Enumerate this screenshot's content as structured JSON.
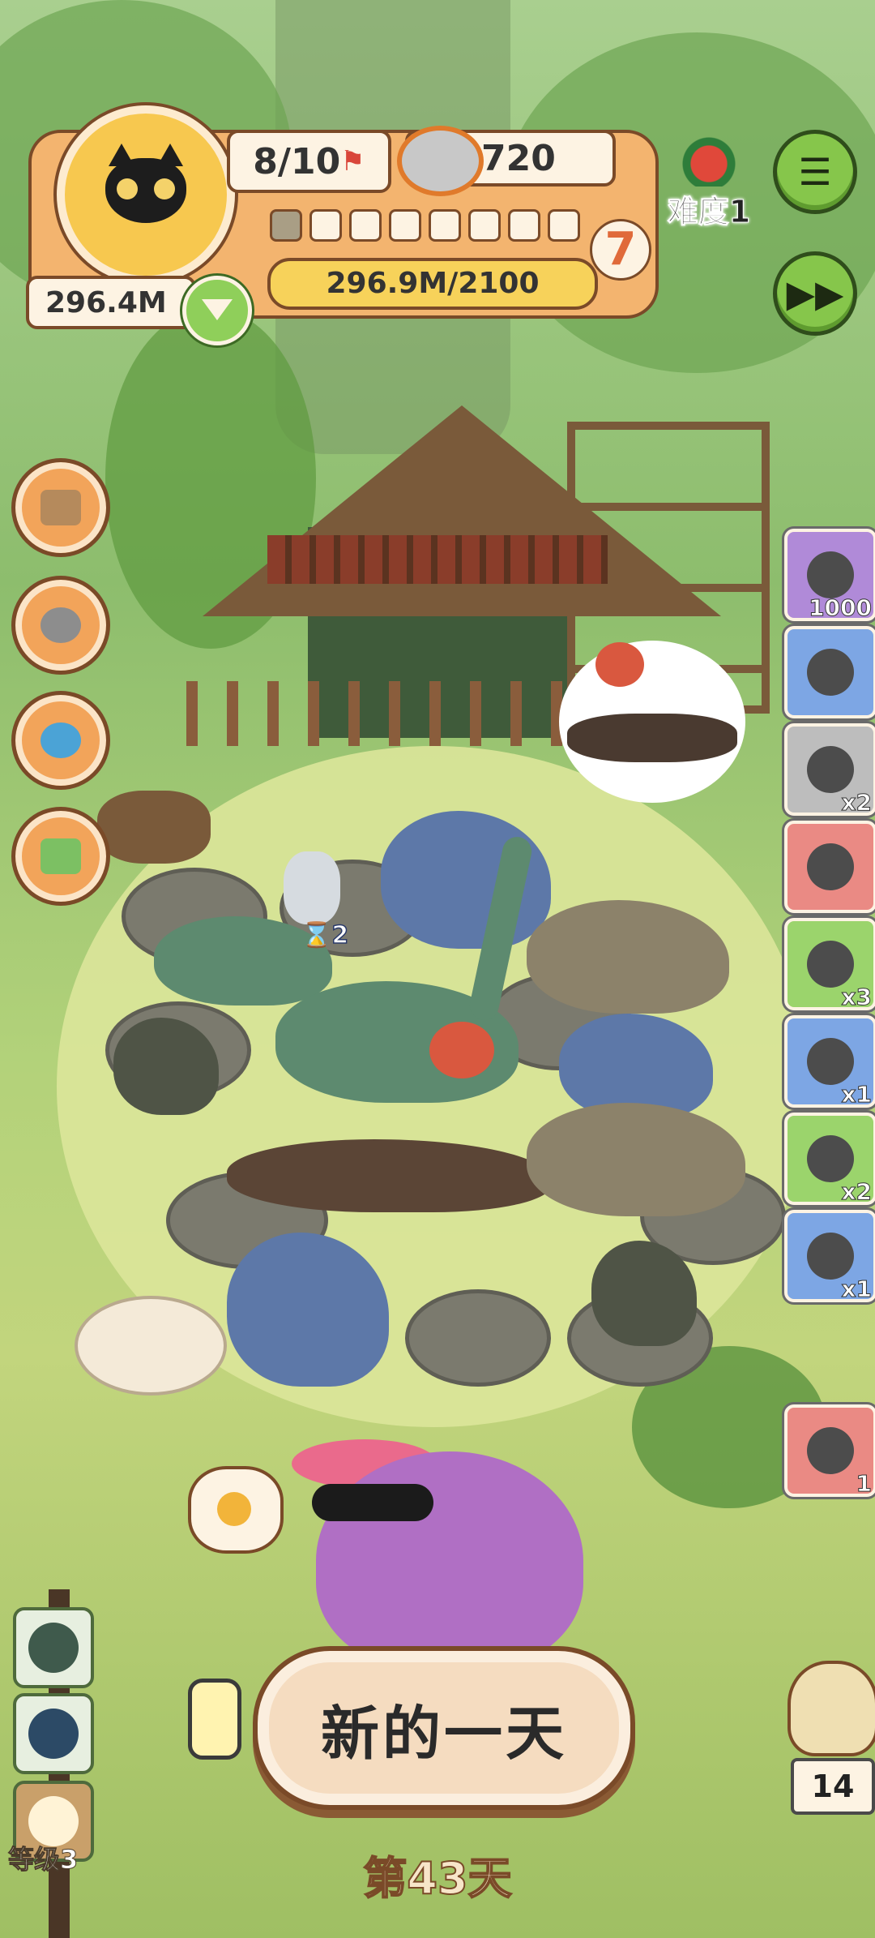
{
  "hud": {
    "level_progress": "8/10",
    "cans": "720",
    "money": "296.4M",
    "xp": "296.9M/2100",
    "level": "7",
    "segments_filled": 1,
    "segments_total": 8
  },
  "difficulty": {
    "label": "难度1"
  },
  "controls": {
    "menu_icon": "list-icon",
    "fast_forward_icon": "fast-forward-icon"
  },
  "side_buttons": [
    "box-icon",
    "food-bowl-icon",
    "joystick-icon",
    "medkit-icon"
  ],
  "items": [
    {
      "name": "ore-basket",
      "count": "1000",
      "color": "#b08ad8"
    },
    {
      "name": "camera",
      "count": "",
      "color": "#7da6e4"
    },
    {
      "name": "engine-part",
      "count": "x2",
      "color": "#bdbdbd"
    },
    {
      "name": "slime-blob",
      "count": "",
      "color": "#ea8a84"
    },
    {
      "name": "leaf-pack",
      "count": "x3",
      "color": "#9bd46c"
    },
    {
      "name": "tin-can",
      "count": "x1",
      "color": "#7da6e4"
    },
    {
      "name": "tent",
      "count": "x2",
      "color": "#9bd46c"
    },
    {
      "name": "donut",
      "count": "x1",
      "color": "#7da6e4"
    },
    {
      "name": "phone-card",
      "count": "1",
      "color": "#ea8a84"
    }
  ],
  "pen": {
    "timer": "2"
  },
  "bottom": {
    "new_day": "新的一天",
    "day": "第43天",
    "level_label": "等级3",
    "owl_count": "14"
  }
}
